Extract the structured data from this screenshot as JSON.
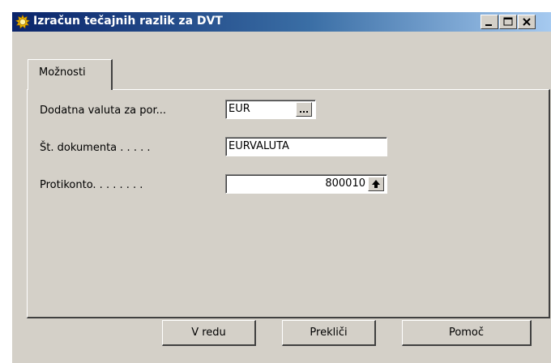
{
  "window": {
    "title": "Izračun tečajnih razlik za DVT",
    "icon": "gear-sun-icon",
    "controls": {
      "minimize": "minimize-icon",
      "maximize": "maximize-icon",
      "close": "close-icon"
    }
  },
  "tabs": [
    {
      "label": "Možnosti",
      "active": true
    }
  ],
  "fields": [
    {
      "label": "Dodatna valuta za por...",
      "value": "EUR",
      "button": "lookup-ellipsis-icon"
    },
    {
      "label": "Št. dokumenta . . . . .",
      "value": "EURVALUTA"
    },
    {
      "label": "Protikonto. . . . . . . .",
      "value": "800010",
      "button": "drilldown-up-arrow-icon"
    }
  ],
  "buttons": {
    "ok": "V redu",
    "cancel": "Prekliči",
    "help": "Pomoč"
  },
  "colors": {
    "title_bar_start": "#0a246a",
    "title_bar_end": "#a6caf0",
    "face": "#d4d0c8"
  }
}
